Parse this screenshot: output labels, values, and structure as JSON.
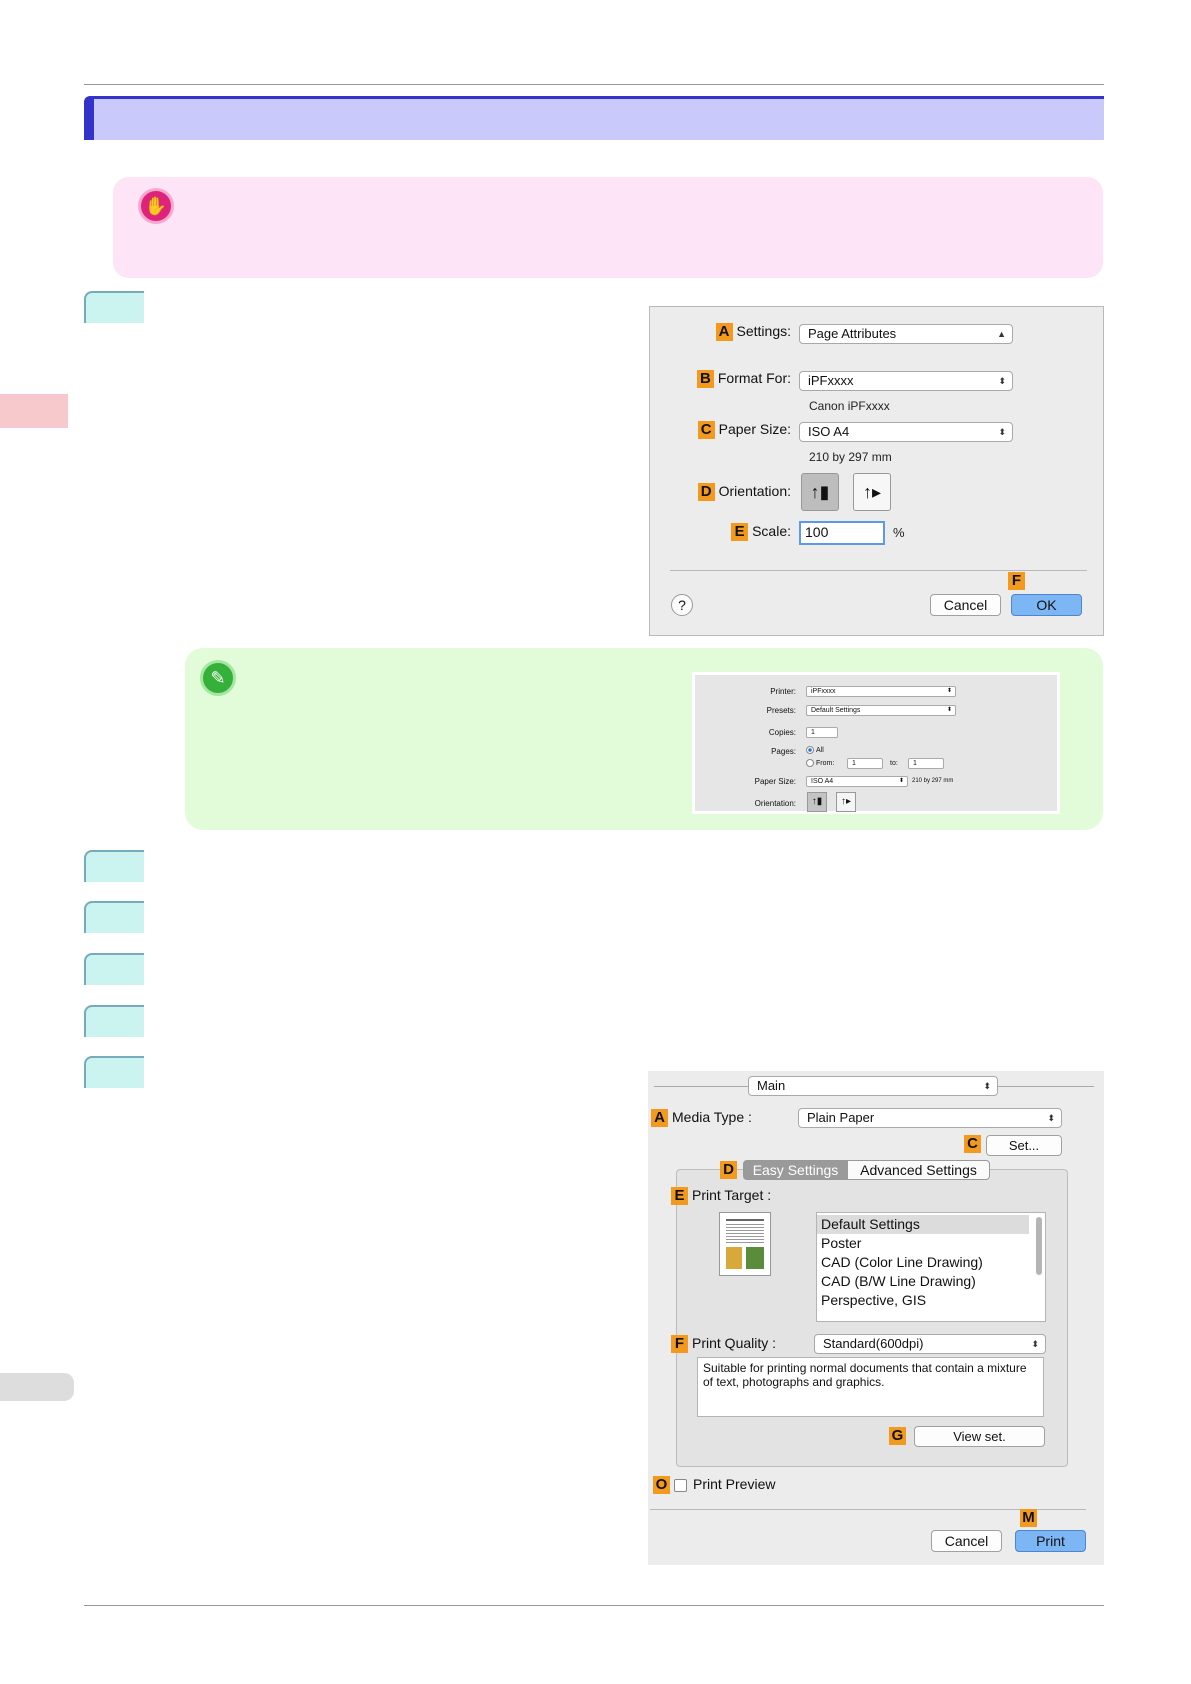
{
  "important_icon": "stop-hand-icon",
  "note_icon": "pencil-note-icon",
  "page_setup": {
    "settings": {
      "badge": "A",
      "label": "Settings:",
      "value": "Page Attributes"
    },
    "format_for": {
      "badge": "B",
      "label": "Format For:",
      "value": "iPFxxxx",
      "sub": "Canon iPFxxxx"
    },
    "paper_size": {
      "badge": "C",
      "label": "Paper Size:",
      "value": "ISO A4",
      "sub": "210 by 297 mm"
    },
    "orientation": {
      "badge": "D",
      "label": "Orientation:",
      "selected": "portrait"
    },
    "scale": {
      "badge": "E",
      "label": "Scale:",
      "value": "100",
      "unit": "%"
    },
    "help": "?",
    "cancel": "Cancel",
    "ok_badge": "F",
    "ok": "OK"
  },
  "print_mini": {
    "printer_label": "Printer:",
    "printer_value": "iPFxxxx",
    "presets_label": "Presets:",
    "presets_value": "Default Settings",
    "copies_label": "Copies:",
    "copies_value": "1",
    "pages_label": "Pages:",
    "pages_all": "All",
    "pages_from": "From:",
    "from_value": "1",
    "to_label": "to:",
    "to_value": "1",
    "paper_label": "Paper Size:",
    "paper_value": "ISO A4",
    "paper_sub": "210 by 297 mm",
    "orientation_label": "Orientation:"
  },
  "print_dialog": {
    "panel": "Main",
    "media_type": {
      "badge": "A",
      "label": "Media Type :",
      "value": "Plain Paper"
    },
    "set_badge": "C",
    "set_button": "Set...",
    "tabs_badge": "D",
    "tabs": [
      "Easy Settings",
      "Advanced Settings"
    ],
    "print_target": {
      "badge": "E",
      "label": "Print Target :",
      "items": [
        "Default Settings",
        "Poster",
        "CAD (Color Line Drawing)",
        "CAD (B/W Line Drawing)",
        "Perspective, GIS"
      ]
    },
    "print_quality": {
      "badge": "F",
      "label": "Print Quality :",
      "value": "Standard(600dpi)",
      "description": "Suitable for printing normal documents that contain a mixture of text, photographs and graphics."
    },
    "view_badge": "G",
    "view_button": "View set.",
    "preview_badge": "O",
    "preview_label": "Print Preview",
    "cancel": "Cancel",
    "print_badge": "M",
    "print": "Print"
  }
}
